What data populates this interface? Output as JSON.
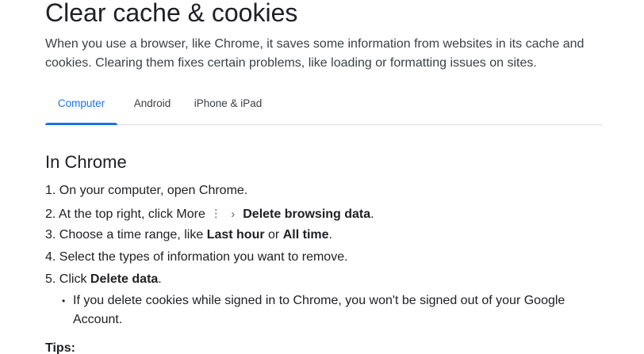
{
  "page": {
    "title": "Clear cache & cookies",
    "intro_line1": "When you use a browser, like Chrome, it saves some information from websites in its cache and",
    "intro_line2": "cookies. Clearing them fixes certain problems, like loading or formatting issues on sites."
  },
  "tabs": [
    {
      "label": "Computer",
      "active": true
    },
    {
      "label": "Android",
      "active": false
    },
    {
      "label": "iPhone & iPad",
      "active": false
    }
  ],
  "section": {
    "heading": "In Chrome",
    "steps": {
      "s1": {
        "num": "1.",
        "text": "On your computer, open Chrome."
      },
      "s2": {
        "num": "2.",
        "pre": "At the top right, click More",
        "more_icon": "more-vert-icon",
        "chevron_icon": "chevron-right-icon",
        "bold": "Delete browsing data",
        "post": "."
      },
      "s3": {
        "num": "3.",
        "pre": "Choose a time range, like",
        "bold1": "Last hour",
        "mid": "or",
        "bold2": "All time",
        "post": "."
      },
      "s4": {
        "num": "4.",
        "text": "Select the types of information you want to remove."
      },
      "s5": {
        "num": "5.",
        "pre": "Click",
        "bold": "Delete data",
        "post": "."
      }
    },
    "bullet": {
      "line1": "If you delete cookies while signed in to Chrome, you won't be signed out of your Google",
      "line2": "Account."
    },
    "tips_label": "Tips:"
  },
  "colors": {
    "accent": "#1a73e8",
    "text": "#202124",
    "secondary_text": "#3c4043",
    "divider": "#dadce0"
  }
}
